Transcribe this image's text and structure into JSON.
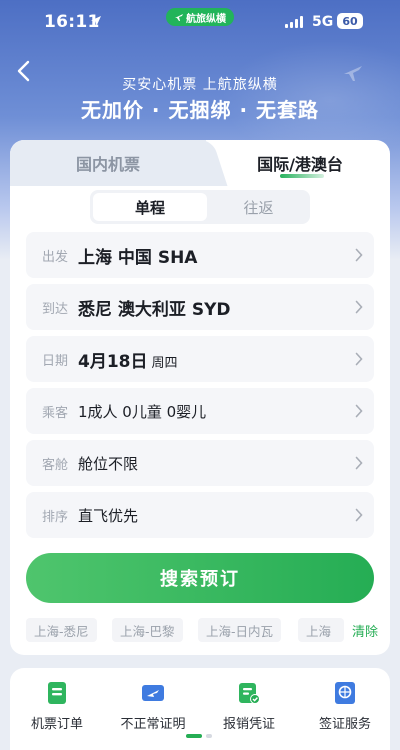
{
  "status_bar": {
    "time": "16:11",
    "app_badge": "航旅纵横",
    "network": "5G",
    "battery": "60"
  },
  "header": {
    "slogan_line1": "买安心机票 上航旅纵横",
    "slogan_line2": "无加价 · 无捆绑 · 无套路"
  },
  "tabs": {
    "domestic": "国内机票",
    "international": "国际/港澳台",
    "active": "international"
  },
  "trip_type": {
    "one_way": "单程",
    "round_trip": "往返",
    "selected": "one_way"
  },
  "form": {
    "depart": {
      "label": "出发",
      "value": "上海 中国 SHA"
    },
    "arrive": {
      "label": "到达",
      "value": "悉尼 澳大利亚 SYD"
    },
    "date": {
      "label": "日期",
      "value": "4月18日",
      "weekday": "周四"
    },
    "passengers": {
      "label": "乘客",
      "value": "1成人 0儿童 0婴儿"
    },
    "cabin": {
      "label": "客舱",
      "value": "舱位不限"
    },
    "sort": {
      "label": "排序",
      "value": "直飞优先"
    }
  },
  "search_button": "搜索预订",
  "history": {
    "items": [
      "上海-悉尼",
      "上海-巴黎",
      "上海-日内瓦",
      "上海"
    ],
    "clear_label": "清除"
  },
  "services": [
    {
      "label": "机票订单",
      "icon": "ticket-order-icon"
    },
    {
      "label": "不正常证明",
      "icon": "irregular-proof-icon"
    },
    {
      "label": "报销凭证",
      "icon": "reimbursement-icon"
    },
    {
      "label": "签证服务",
      "icon": "visa-icon"
    }
  ],
  "colors": {
    "brand_green": "#25ad54",
    "hero_blue": "#4d6fc4"
  }
}
